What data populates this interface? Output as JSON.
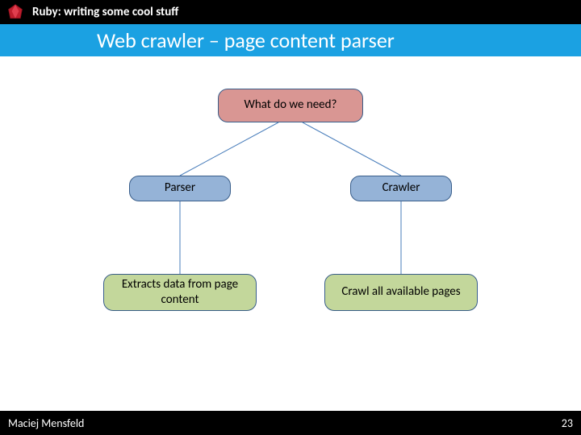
{
  "header": {
    "text": "Ruby: writing some cool stuff"
  },
  "title": "Web crawler – page content parser",
  "diagram": {
    "root": {
      "label": "What do we need?"
    },
    "mid_left": {
      "label": "Parser"
    },
    "mid_right": {
      "label": "Crawler"
    },
    "leaf_left": {
      "label": "Extracts data from page content"
    },
    "leaf_right": {
      "label": "Crawl all available pages"
    }
  },
  "footer": {
    "author": "Maciej Mensfeld",
    "page": "23"
  }
}
